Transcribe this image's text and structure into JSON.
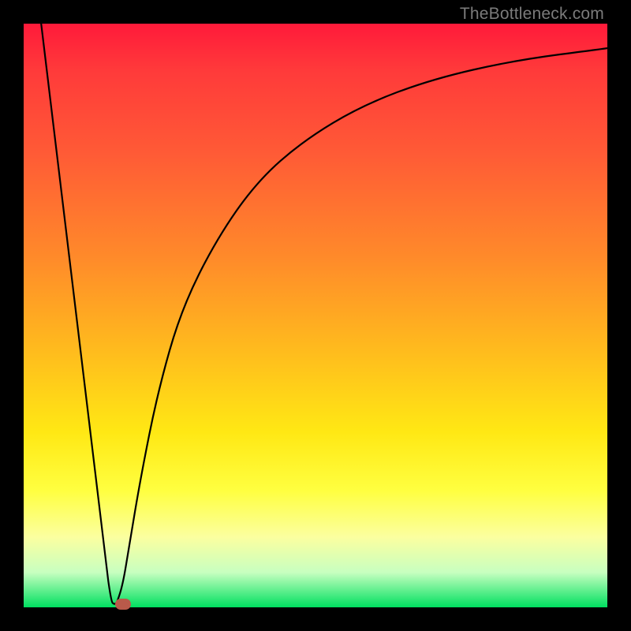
{
  "watermark": "TheBottleneck.com",
  "chart_data": {
    "type": "line",
    "title": "",
    "xlabel": "",
    "ylabel": "",
    "xlim": [
      0,
      100
    ],
    "ylim": [
      0,
      100
    ],
    "grid": false,
    "series": [
      {
        "name": "curve",
        "x": [
          3,
          14,
          15,
          15.5,
          16,
          17,
          18,
          20,
          23,
          27,
          33,
          40,
          48,
          58,
          70,
          84,
          100
        ],
        "y": [
          100,
          8,
          1,
          0.5,
          0.8,
          4,
          10,
          22,
          37,
          51,
          63,
          73,
          80,
          86,
          90.5,
          93.7,
          95.8
        ]
      }
    ],
    "marker": {
      "x": 17,
      "y": 0.5,
      "color": "#b95a4a"
    },
    "background_gradient": {
      "stops": [
        {
          "color": "#ff1a3a",
          "pos": 0
        },
        {
          "color": "#ff5a36",
          "pos": 22
        },
        {
          "color": "#ffb81e",
          "pos": 55
        },
        {
          "color": "#ffff40",
          "pos": 80
        },
        {
          "color": "#00e060",
          "pos": 100
        }
      ]
    }
  }
}
